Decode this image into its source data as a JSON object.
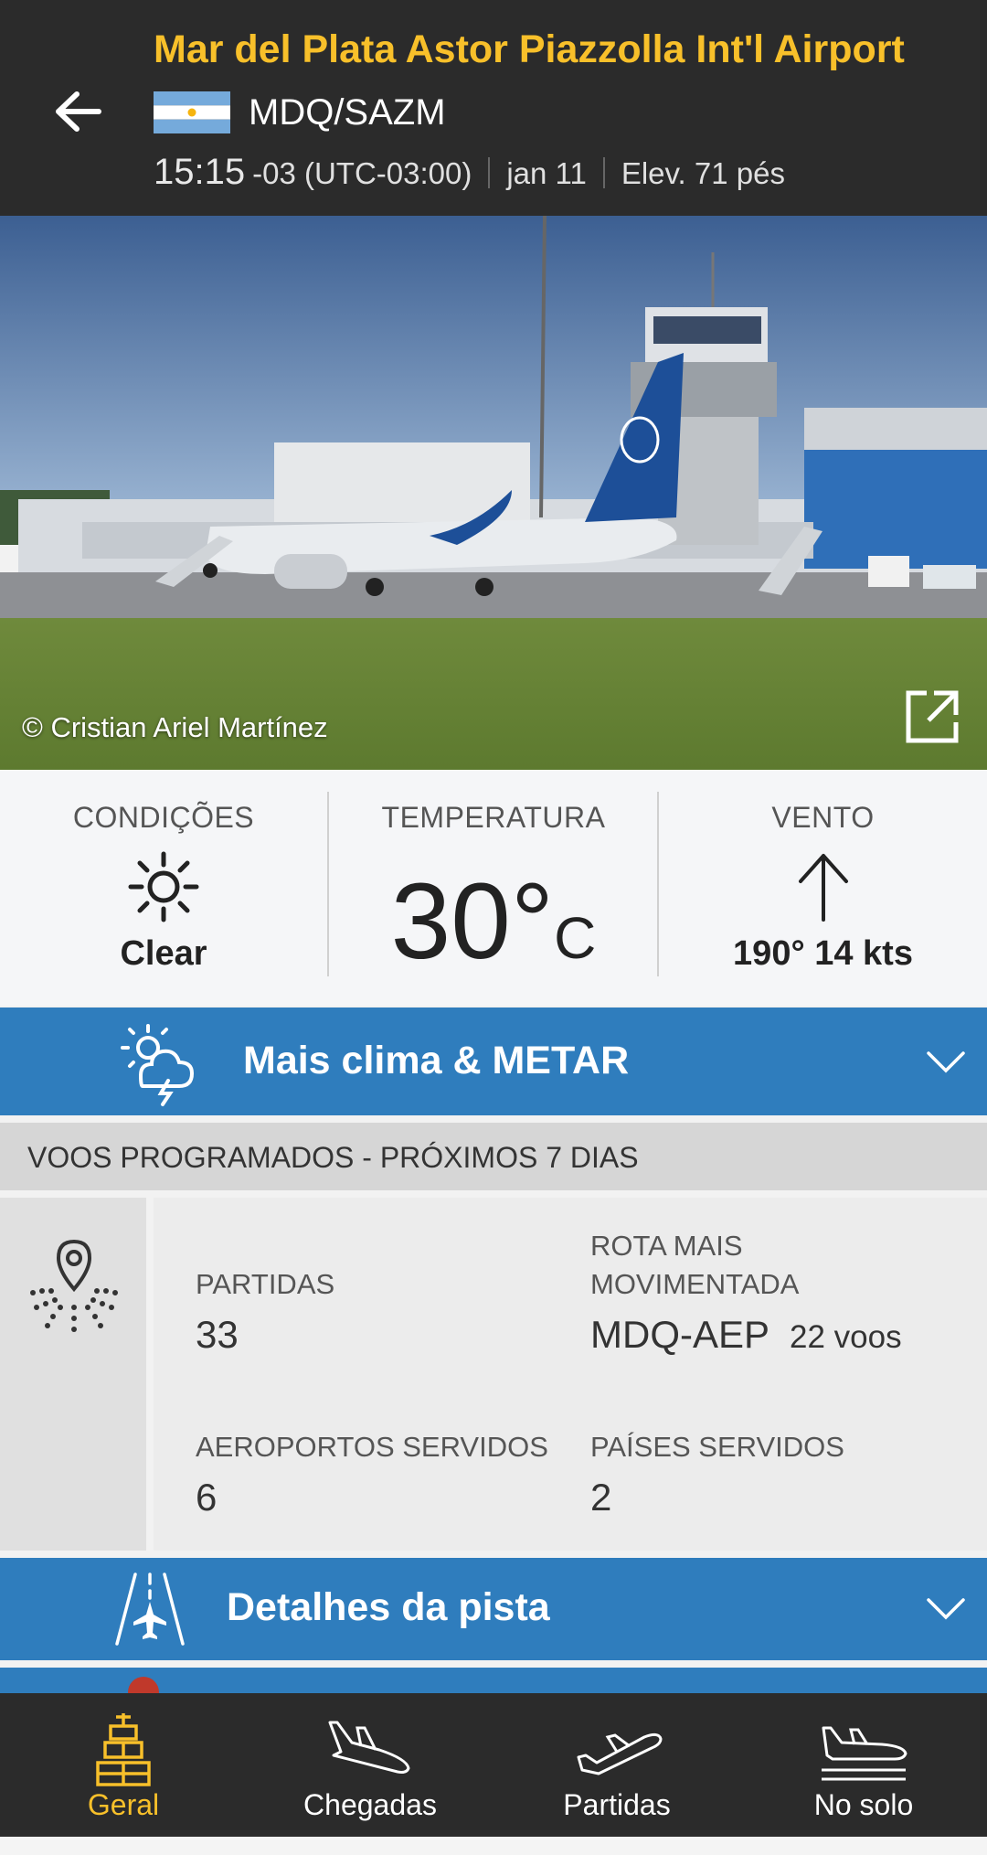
{
  "header": {
    "title": "Mar del Plata Astor Piazzolla Int'l Airport",
    "codes": "MDQ/SAZM",
    "time": "15:15",
    "timezone": "-03 (UTC-03:00)",
    "date": "jan 11",
    "elevation": "Elev. 71 pés"
  },
  "photo": {
    "credit": "© Cristian Ariel Martínez"
  },
  "weather": {
    "conditions_label": "CONDIÇÕES",
    "conditions_value": "Clear",
    "temperature_label": "TEMPERATURA",
    "temperature_value": "30°",
    "temperature_unit": "C",
    "wind_label": "VENTO",
    "wind_value": "190° 14 kts"
  },
  "weather_bar": {
    "label": "Mais clima & METAR"
  },
  "scheduled": {
    "header": "VOOS PROGRAMADOS - PRÓXIMOS 7 DIAS",
    "departures_label": "PARTIDAS",
    "departures_value": "33",
    "busiest_route_label_1": "ROTA MAIS",
    "busiest_route_label_2": "MOVIMENTADA",
    "busiest_route_value": "MDQ-AEP",
    "busiest_route_flights": "22 voos",
    "airports_label": "AEROPORTOS SERVIDOS",
    "airports_value": "6",
    "countries_label": "PAÍSES SERVIDOS",
    "countries_value": "2"
  },
  "runway_bar": {
    "label": "Detalhes da pista"
  },
  "nav": {
    "items": [
      {
        "label": "Geral",
        "icon": "airport-tower-icon",
        "active": true
      },
      {
        "label": "Chegadas",
        "icon": "arrival-plane-icon"
      },
      {
        "label": "Partidas",
        "icon": "departure-plane-icon"
      },
      {
        "label": "No solo",
        "icon": "plane-on-ground-icon"
      }
    ]
  },
  "colors": {
    "header_bg": "#2b2b2b",
    "accent_yellow": "#f8c02a",
    "bar_blue": "#2f7dbd"
  }
}
